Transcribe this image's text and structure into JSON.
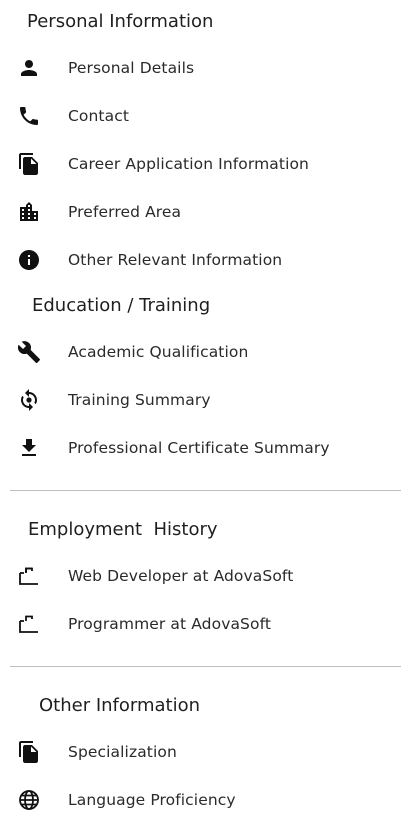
{
  "sections": {
    "personal": {
      "title": "Personal Information",
      "items": [
        {
          "label": "Personal Details",
          "icon": "person-icon"
        },
        {
          "label": "Contact",
          "icon": "phone-icon"
        },
        {
          "label": "Career Application Information",
          "icon": "file-copy-icon"
        },
        {
          "label": "Preferred Area",
          "icon": "city-icon"
        },
        {
          "label": "Other Relevant Information",
          "icon": "info-icon"
        }
      ]
    },
    "education": {
      "title": "Education / Training",
      "items": [
        {
          "label": "Academic Qualification",
          "icon": "wrench-icon"
        },
        {
          "label": "Training Summary",
          "icon": "sync-icon"
        },
        {
          "label": "Professional Certificate Summary",
          "icon": "download-icon"
        }
      ]
    },
    "employment": {
      "title": "Employment  History",
      "items": [
        {
          "label": "Web Developer at AdovaSoft",
          "icon": "briefcase-outline-icon"
        },
        {
          "label": "Programmer at AdovaSoft",
          "icon": "briefcase-outline-icon"
        }
      ]
    },
    "other": {
      "title": "Other Information",
      "items": [
        {
          "label": "Specialization",
          "icon": "file-copy-icon"
        },
        {
          "label": "Language Proficiency",
          "icon": "globe-icon"
        }
      ]
    }
  },
  "colors": {
    "icon": "#111111",
    "divider": "#bdbdbd",
    "text": "#2a2a2a"
  }
}
